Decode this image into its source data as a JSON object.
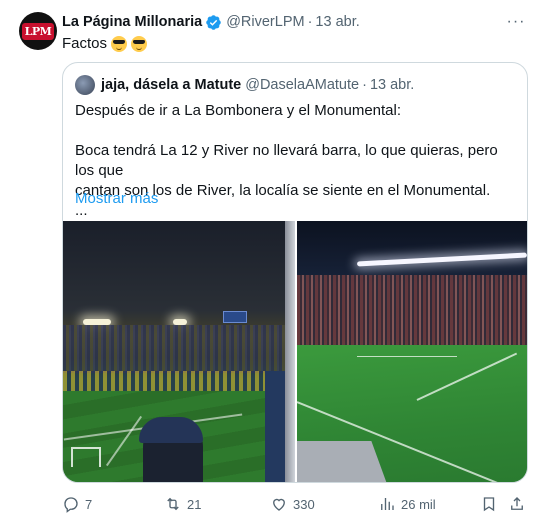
{
  "author": {
    "name": "La Página Millonaria",
    "handle": "@RiverLPM",
    "separator": "·",
    "date": "13 abr.",
    "avatar_text": "LPM",
    "verified_color": "#1d9bf0"
  },
  "tweet": {
    "text": "Factos",
    "emoji": [
      "😎",
      "😎"
    ]
  },
  "quote": {
    "name": "jaja, dásela a Matute",
    "handle": "@DaselaAMatute",
    "separator": "·",
    "date": "13 abr.",
    "lines": [
      "Después de ir a La Bombonera y el Monumental:",
      "Boca tendrá La 12 y River no llevará barra, lo que quieras, pero los que",
      "cantan son los de River, la localía se siente en el Monumental.",
      "..."
    ],
    "show_more": "Mostrar más"
  },
  "media": {
    "photos": [
      "stadium-la-bombonera-photo",
      "stadium-monumental-photo"
    ]
  },
  "actions": {
    "replies": "7",
    "retweets": "21",
    "likes": "330",
    "views": "26 mil"
  },
  "colors": {
    "accent": "#1d9bf0",
    "secondary_text": "#536471",
    "border": "#cfd9de"
  }
}
